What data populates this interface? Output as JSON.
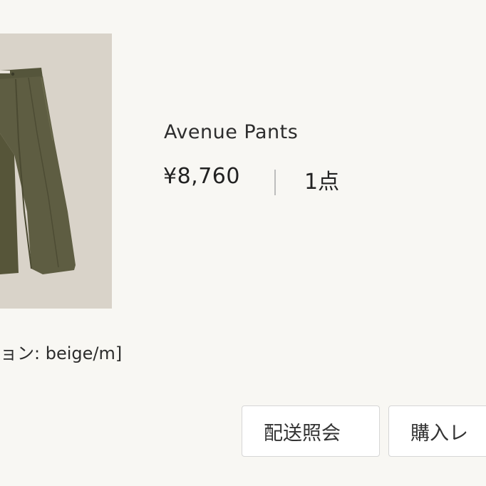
{
  "product": {
    "name": "Avenue Pants",
    "price": "¥8,760",
    "quantity": "1点",
    "variation": "ョン: beige/m]",
    "image_alt": "olive wide-leg pants"
  },
  "actions": {
    "tracking_label": "配送照会",
    "receipt_label": "購入レ"
  },
  "colors": {
    "background": "#f8f7f3",
    "image_background": "#d9d3c9",
    "pants": "#5c5b40"
  }
}
